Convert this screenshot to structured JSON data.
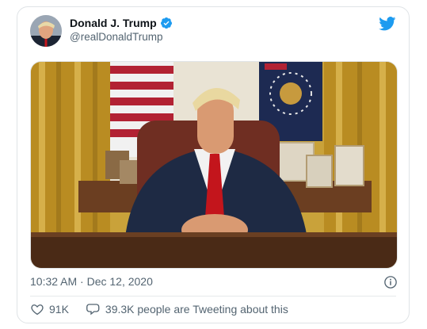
{
  "tweet": {
    "author": {
      "display_name": "Donald J. Trump",
      "handle": "@realDonaldTrump",
      "verified": true
    },
    "timestamp": "10:32 AM · Dec 12, 2020",
    "likes": "91K",
    "discussion": "39.3K people are Tweeting about this"
  },
  "icons": {
    "brand": "twitter-bird-icon",
    "verified": "verified-badge-icon",
    "info": "info-icon",
    "like": "heart-icon",
    "reply": "speech-bubble-icon"
  },
  "colors": {
    "brand_blue": "#1d9bf0",
    "text_primary": "#0f1419",
    "text_secondary": "#536471"
  }
}
